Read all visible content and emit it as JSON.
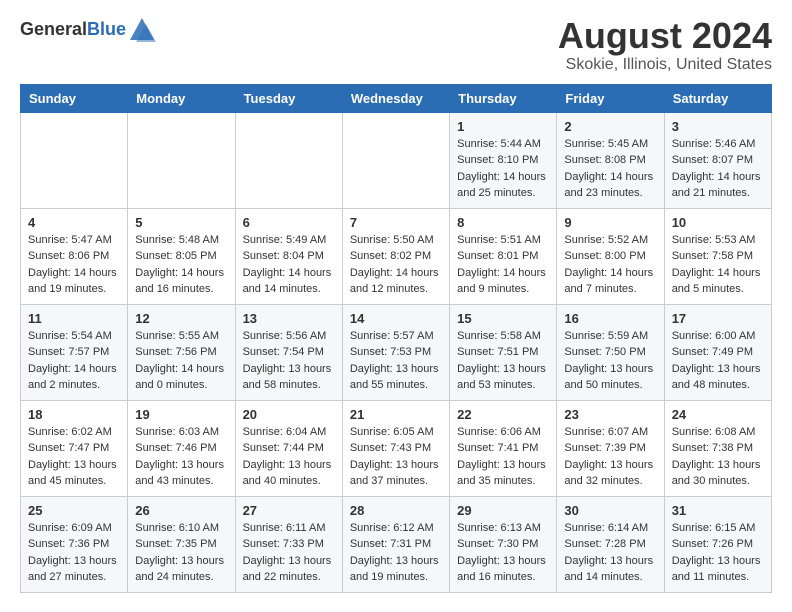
{
  "header": {
    "logo_general": "General",
    "logo_blue": "Blue",
    "title": "August 2024",
    "subtitle": "Skokie, Illinois, United States"
  },
  "days_of_week": [
    "Sunday",
    "Monday",
    "Tuesday",
    "Wednesday",
    "Thursday",
    "Friday",
    "Saturday"
  ],
  "weeks": [
    [
      {
        "day": "",
        "info": ""
      },
      {
        "day": "",
        "info": ""
      },
      {
        "day": "",
        "info": ""
      },
      {
        "day": "",
        "info": ""
      },
      {
        "day": "1",
        "info": "Sunrise: 5:44 AM\nSunset: 8:10 PM\nDaylight: 14 hours\nand 25 minutes."
      },
      {
        "day": "2",
        "info": "Sunrise: 5:45 AM\nSunset: 8:08 PM\nDaylight: 14 hours\nand 23 minutes."
      },
      {
        "day": "3",
        "info": "Sunrise: 5:46 AM\nSunset: 8:07 PM\nDaylight: 14 hours\nand 21 minutes."
      }
    ],
    [
      {
        "day": "4",
        "info": "Sunrise: 5:47 AM\nSunset: 8:06 PM\nDaylight: 14 hours\nand 19 minutes."
      },
      {
        "day": "5",
        "info": "Sunrise: 5:48 AM\nSunset: 8:05 PM\nDaylight: 14 hours\nand 16 minutes."
      },
      {
        "day": "6",
        "info": "Sunrise: 5:49 AM\nSunset: 8:04 PM\nDaylight: 14 hours\nand 14 minutes."
      },
      {
        "day": "7",
        "info": "Sunrise: 5:50 AM\nSunset: 8:02 PM\nDaylight: 14 hours\nand 12 minutes."
      },
      {
        "day": "8",
        "info": "Sunrise: 5:51 AM\nSunset: 8:01 PM\nDaylight: 14 hours\nand 9 minutes."
      },
      {
        "day": "9",
        "info": "Sunrise: 5:52 AM\nSunset: 8:00 PM\nDaylight: 14 hours\nand 7 minutes."
      },
      {
        "day": "10",
        "info": "Sunrise: 5:53 AM\nSunset: 7:58 PM\nDaylight: 14 hours\nand 5 minutes."
      }
    ],
    [
      {
        "day": "11",
        "info": "Sunrise: 5:54 AM\nSunset: 7:57 PM\nDaylight: 14 hours\nand 2 minutes."
      },
      {
        "day": "12",
        "info": "Sunrise: 5:55 AM\nSunset: 7:56 PM\nDaylight: 14 hours\nand 0 minutes."
      },
      {
        "day": "13",
        "info": "Sunrise: 5:56 AM\nSunset: 7:54 PM\nDaylight: 13 hours\nand 58 minutes."
      },
      {
        "day": "14",
        "info": "Sunrise: 5:57 AM\nSunset: 7:53 PM\nDaylight: 13 hours\nand 55 minutes."
      },
      {
        "day": "15",
        "info": "Sunrise: 5:58 AM\nSunset: 7:51 PM\nDaylight: 13 hours\nand 53 minutes."
      },
      {
        "day": "16",
        "info": "Sunrise: 5:59 AM\nSunset: 7:50 PM\nDaylight: 13 hours\nand 50 minutes."
      },
      {
        "day": "17",
        "info": "Sunrise: 6:00 AM\nSunset: 7:49 PM\nDaylight: 13 hours\nand 48 minutes."
      }
    ],
    [
      {
        "day": "18",
        "info": "Sunrise: 6:02 AM\nSunset: 7:47 PM\nDaylight: 13 hours\nand 45 minutes."
      },
      {
        "day": "19",
        "info": "Sunrise: 6:03 AM\nSunset: 7:46 PM\nDaylight: 13 hours\nand 43 minutes."
      },
      {
        "day": "20",
        "info": "Sunrise: 6:04 AM\nSunset: 7:44 PM\nDaylight: 13 hours\nand 40 minutes."
      },
      {
        "day": "21",
        "info": "Sunrise: 6:05 AM\nSunset: 7:43 PM\nDaylight: 13 hours\nand 37 minutes."
      },
      {
        "day": "22",
        "info": "Sunrise: 6:06 AM\nSunset: 7:41 PM\nDaylight: 13 hours\nand 35 minutes."
      },
      {
        "day": "23",
        "info": "Sunrise: 6:07 AM\nSunset: 7:39 PM\nDaylight: 13 hours\nand 32 minutes."
      },
      {
        "day": "24",
        "info": "Sunrise: 6:08 AM\nSunset: 7:38 PM\nDaylight: 13 hours\nand 30 minutes."
      }
    ],
    [
      {
        "day": "25",
        "info": "Sunrise: 6:09 AM\nSunset: 7:36 PM\nDaylight: 13 hours\nand 27 minutes."
      },
      {
        "day": "26",
        "info": "Sunrise: 6:10 AM\nSunset: 7:35 PM\nDaylight: 13 hours\nand 24 minutes."
      },
      {
        "day": "27",
        "info": "Sunrise: 6:11 AM\nSunset: 7:33 PM\nDaylight: 13 hours\nand 22 minutes."
      },
      {
        "day": "28",
        "info": "Sunrise: 6:12 AM\nSunset: 7:31 PM\nDaylight: 13 hours\nand 19 minutes."
      },
      {
        "day": "29",
        "info": "Sunrise: 6:13 AM\nSunset: 7:30 PM\nDaylight: 13 hours\nand 16 minutes."
      },
      {
        "day": "30",
        "info": "Sunrise: 6:14 AM\nSunset: 7:28 PM\nDaylight: 13 hours\nand 14 minutes."
      },
      {
        "day": "31",
        "info": "Sunrise: 6:15 AM\nSunset: 7:26 PM\nDaylight: 13 hours\nand 11 minutes."
      }
    ]
  ]
}
